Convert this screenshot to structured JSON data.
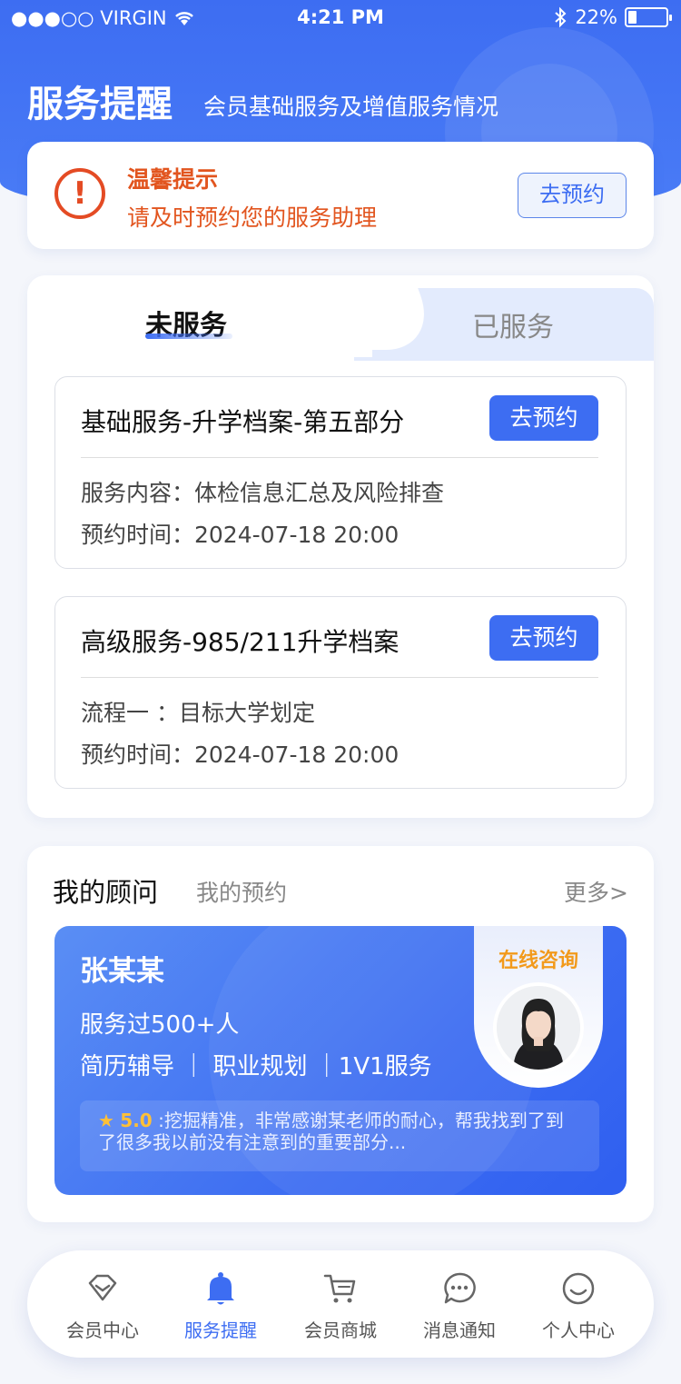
{
  "status_bar": {
    "carrier": "●●●○○ VIRGIN",
    "time": "4:21 PM",
    "battery": "22%",
    "battery_level": 0.22
  },
  "header": {
    "title": "服务提醒",
    "subtitle": "会员基础服务及增值服务情况"
  },
  "notice": {
    "title": "温馨提示",
    "message": "请及时预约您的服务助理",
    "button": "去预约"
  },
  "service_tabs": {
    "active": "未服务",
    "inactive": "已服务"
  },
  "services": [
    {
      "title": "基础服务-升学档案-第五部分",
      "button": "去预约",
      "line1": "服务内容：体检信息汇总及风险排查",
      "line2": "预约时间：2024-07-18    20:00"
    },
    {
      "title": "高级服务-985/211升学档案",
      "button": "去预约",
      "line1": "流程一  ：目标大学划定",
      "line2": "预约时间：2024-07-18    20:00"
    }
  ],
  "advisor": {
    "tab_active": "我的顾问",
    "tab_inactive": "我的预约",
    "more": "更多>",
    "name": "张某某",
    "served": "服务过500+人",
    "tags": "简历辅导 ｜ 职业规划 ｜1V1服务",
    "badge": "在线咨询",
    "rating": "5.0",
    "review": ":挖掘精准，非常感谢某老师的耐心，帮我找到了到了很多我以前没有注意到的重要部分..."
  },
  "tabbar": [
    {
      "label": "会员中心",
      "icon": "diamond-icon"
    },
    {
      "label": "服务提醒",
      "icon": "bell-icon"
    },
    {
      "label": "会员商城",
      "icon": "cart-icon"
    },
    {
      "label": "消息通知",
      "icon": "chat-icon"
    },
    {
      "label": "个人中心",
      "icon": "smile-icon"
    }
  ],
  "colors": {
    "primary": "#3d6df2",
    "warning": "#e2551f",
    "gold": "#f29a1b"
  }
}
